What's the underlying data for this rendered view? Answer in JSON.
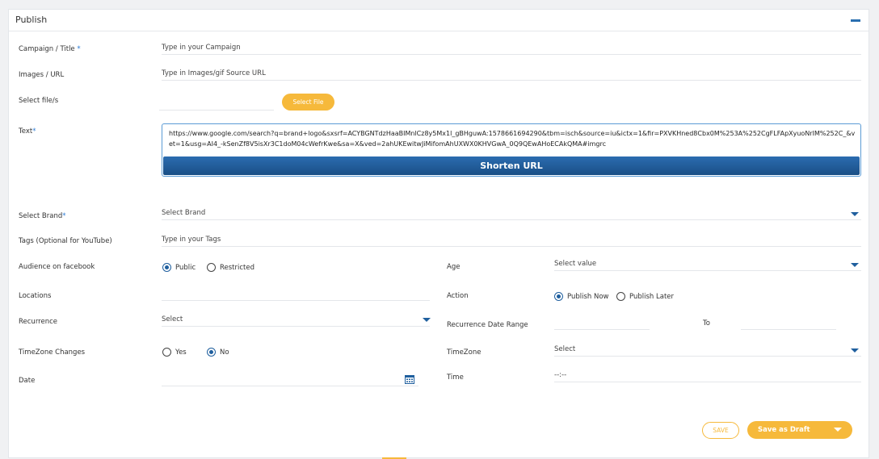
{
  "panel": {
    "title": "Publish"
  },
  "campaign": {
    "label": "Campaign / Title",
    "required_mark": "*",
    "placeholder": "Type in your Campaign"
  },
  "images": {
    "label": "Images / URL",
    "placeholder": "Type in Images/gif Source URL"
  },
  "file": {
    "label": "Select file/s",
    "button": "Select File"
  },
  "text": {
    "label": "Text",
    "required_mark": "*",
    "value": "https://www.google.com/search?q=brand+logo&sxsrf=ACYBGNTdzHaaBIMnlCz8y5Mx1l_gBHguwA:1578661694290&tbm=isch&source=iu&ictx=1&fir=PXVKHned8Cbx0M%253A%252CgFLFApXyuoNrIM%252C_&vet=1&usg=AI4_-kSenZf8V5isXr3C1doM04cWefrKwe&sa=X&ved=2ahUKEwitwJiMifomAhUXWX0KHVGwA_0Q9QEwAHoECAkQMA#imgrc",
    "shorten_button": "Shorten URL"
  },
  "brand": {
    "label": "Select Brand",
    "required_mark": "*",
    "value": "Select Brand"
  },
  "tags": {
    "label": "Tags (Optional for YouTube)",
    "placeholder": "Type in your Tags"
  },
  "audience": {
    "label": "Audience on facebook",
    "options": [
      "Public",
      "Restricted"
    ],
    "selected": "Public"
  },
  "age": {
    "label": "Age",
    "value": "Select value"
  },
  "locations": {
    "label": "Locations"
  },
  "action": {
    "label": "Action",
    "options": [
      "Publish Now",
      "Publish Later"
    ],
    "selected": "Publish Now"
  },
  "recurrence": {
    "label": "Recurrence",
    "value": "Select"
  },
  "recurrence_range": {
    "label": "Recurrence Date Range",
    "to_label": "To"
  },
  "timezone_changes": {
    "label": "TimeZone Changes",
    "options": [
      "Yes",
      "No"
    ],
    "selected": "No"
  },
  "timezone": {
    "label": "TimeZone",
    "value": "Select"
  },
  "date": {
    "label": "Date"
  },
  "time": {
    "label": "Time",
    "value": "--:--"
  },
  "footer": {
    "save": "SAVE",
    "draft": "Save as Draft"
  },
  "colors": {
    "accent": "#f6b93b",
    "primary": "#1f5f9e"
  }
}
